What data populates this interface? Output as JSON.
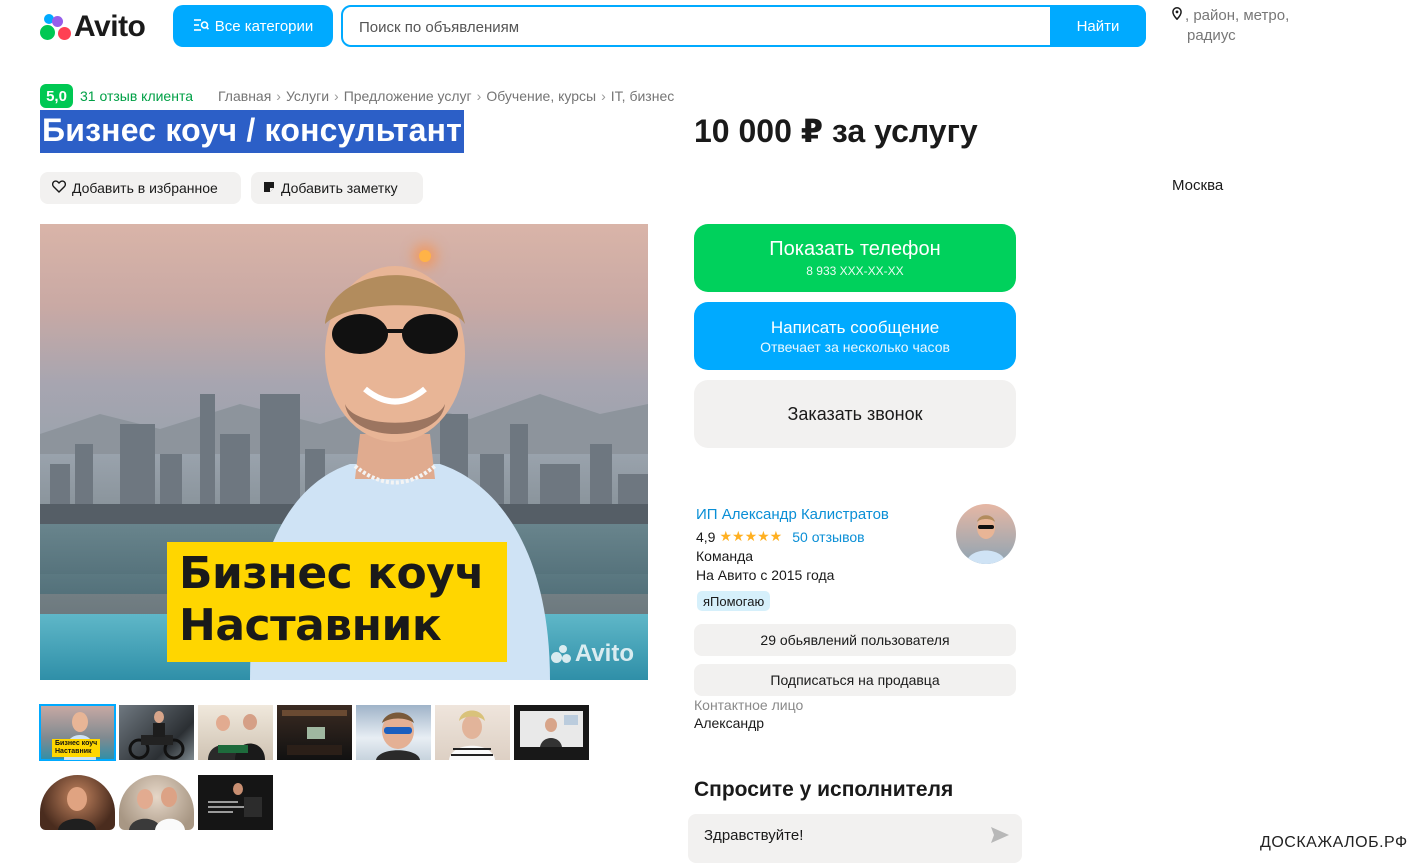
{
  "header": {
    "logo_text": "Avito",
    "categories_label": "Все категории",
    "search_placeholder": "Поиск по объявлениям",
    "search_button": "Найти",
    "location_city": "Москва",
    "location_rest": ", район, метро,",
    "location_rest2": "радиус"
  },
  "breadcrumb": {
    "rating": "5,0",
    "reviews": "31 отзыв клиента",
    "items": [
      "Главная",
      "Услуги",
      "Предложение услуг",
      "Обучение, курсы",
      "IT, бизнес"
    ],
    "separator": "›"
  },
  "listing": {
    "title": "Бизнес коуч / консультант",
    "price": "10 000 ₽ за услугу",
    "favorite_label": "Добавить в избранное",
    "note_label": "Добавить заметку"
  },
  "photo": {
    "caption_line1": "Бизнес коуч",
    "caption_line2": "Наставник",
    "watermark": "Avito",
    "thumb_caption1": "Бизнес коуч",
    "thumb_caption2": "Наставник"
  },
  "actions": {
    "phone_label": "Показать телефон",
    "phone_number": "8 933 XXX-XX-XX",
    "message_label": "Написать сообщение",
    "message_sub": "Отвечает за несколько часов",
    "call_label": "Заказать звонок"
  },
  "seller": {
    "name": "ИП Александр Калистратов",
    "rating": "4,9",
    "stars": "★★★★★",
    "reviews": "50 отзывов",
    "type": "Команда",
    "since": "На Авито с 2015 года",
    "badge": "яПомогаю",
    "ads_button": "29 обьявлений пользователя",
    "subscribe_button": "Подписаться на продавца",
    "contact_label": "Контактное лицо",
    "contact_name": "Александр"
  },
  "ask": {
    "title": "Спросите у исполнителя",
    "input_value": "Здравствуйте!"
  },
  "footer": {
    "site_watermark": "ДОСКАЖАЛОБ.РФ"
  },
  "colors": {
    "accent": "#00aaff",
    "green": "#00d15c",
    "title_highlight": "#2c5fc7",
    "caption_yellow": "#ffd600"
  }
}
